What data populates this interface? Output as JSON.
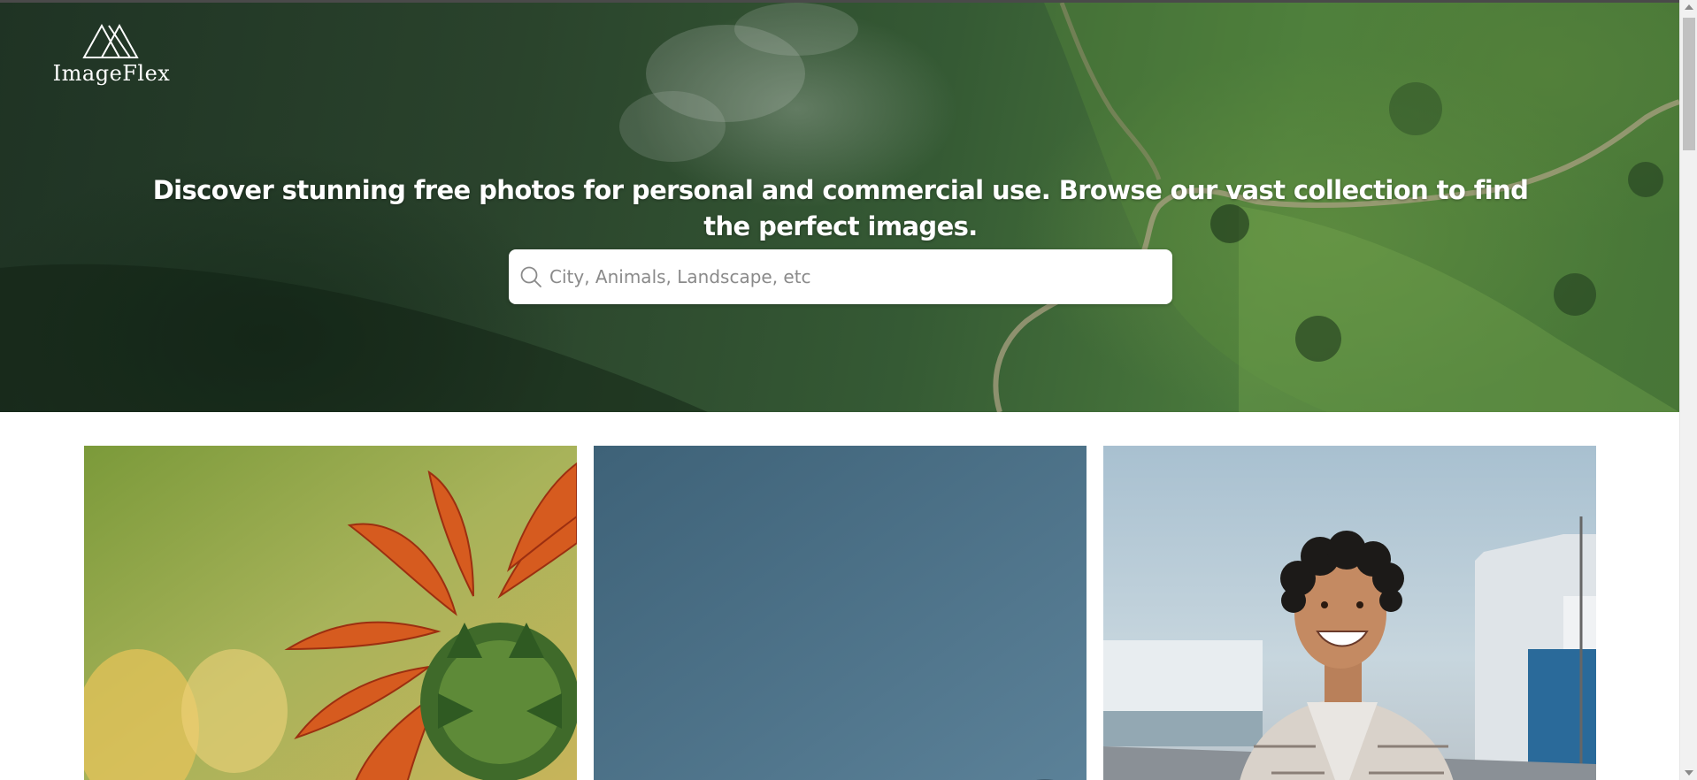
{
  "brand": {
    "name": "ImageFlex",
    "logo_icon": "mountain-triangles-icon"
  },
  "hero": {
    "headline": "Discover stunning free photos for personal and commercial use. Browse our vast collection to find the perfect images.",
    "background": "aerial-mountain-road-photo"
  },
  "search": {
    "placeholder": "City, Animals, Landscape, etc",
    "value": "",
    "icon": "search-icon"
  },
  "gallery": {
    "photos": [
      {
        "subject": "sunflower"
      },
      {
        "subject": "blue-sky"
      },
      {
        "subject": "smiling-man"
      }
    ]
  },
  "colors": {
    "hero_green": "#355a34",
    "white": "#ffffff",
    "placeholder": "#8a8a8a"
  }
}
